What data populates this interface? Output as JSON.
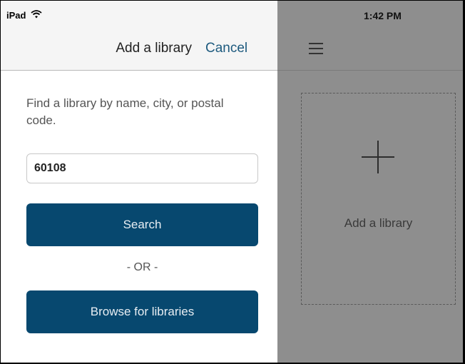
{
  "status_bar": {
    "device": "iPad",
    "time": "1:42 PM"
  },
  "icons": {
    "wifi": "wifi-icon",
    "menu": "hamburger-menu-icon",
    "plus": "plus-icon"
  },
  "add_library_panel": {
    "title": "Add a library",
    "cancel_label": "Cancel",
    "instructions": "Find a library by name, city, or postal code.",
    "search_value": "60108",
    "search_button_label": "Search",
    "or_label": "- OR -",
    "browse_button_label": "Browse for libraries"
  },
  "main": {
    "add_tile_label": "Add a library"
  },
  "colors": {
    "button_bg": "#07486f",
    "link": "#1d5a7e",
    "dimmed_background": "#8e8e8e"
  }
}
